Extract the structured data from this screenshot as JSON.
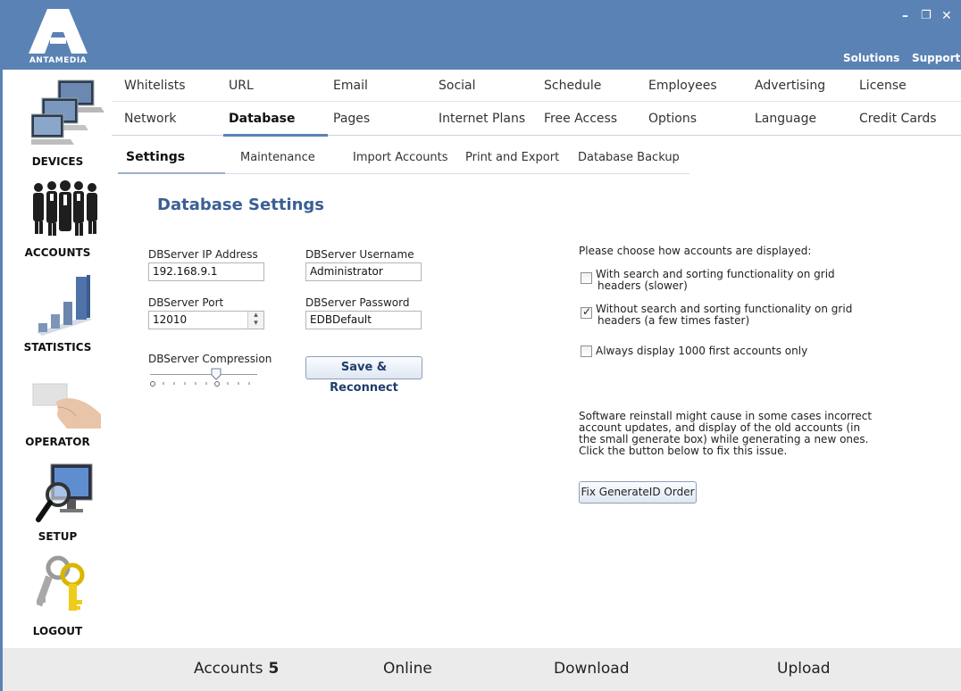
{
  "app": {
    "logo_text": "ANTAMEDIA",
    "minimize_glyph": "–",
    "restore_glyph": "❐",
    "close_glyph": "✕",
    "solutions_label": "Solutions",
    "support_label": "Support"
  },
  "sidebar": {
    "items": [
      {
        "label": "DEVICES",
        "icon": "computers-icon"
      },
      {
        "label": "ACCOUNTS",
        "icon": "people-icon"
      },
      {
        "label": "STATISTICS",
        "icon": "bar-chart-icon"
      },
      {
        "label": "OPERATOR",
        "icon": "hand-card-icon"
      },
      {
        "label": "SETUP",
        "icon": "monitor-magnifier-icon"
      },
      {
        "label": "LOGOUT",
        "icon": "keys-icon"
      }
    ]
  },
  "tabs_row1": [
    "Whitelists",
    "URL",
    "Email",
    "Social",
    "Schedule",
    "Employees",
    "Advertising",
    "License"
  ],
  "tabs_row2": [
    "Network",
    "Database",
    "Pages",
    "Internet Plans",
    "Free Access",
    "Options",
    "Language",
    "Credit Cards"
  ],
  "active_tab": "Database",
  "subtabs": [
    "Settings",
    "Maintenance",
    "Import Accounts",
    "Print and Export",
    "Database Backup"
  ],
  "active_subtab": "Settings",
  "form": {
    "title": "Database Settings",
    "ip_label": "DBServer IP Address",
    "ip_value": "192.168.9.1",
    "username_label": "DBServer Username",
    "username_value": "Administrator",
    "port_label": "DBServer Port",
    "port_value": "12010",
    "password_label": "DBServer Password",
    "password_value": "EDBDefault",
    "compression_label": "DBServer Compression",
    "compression_level": 0.63,
    "save_button": "Save & Reconnect"
  },
  "display_options": {
    "heading": "Please choose how accounts are displayed:",
    "options": [
      {
        "line1": "With search and sorting functionality on grid",
        "line2": "headers (slower)",
        "checked": false
      },
      {
        "line1": "Without search and sorting functionality on grid",
        "line2": "headers (a few times faster)",
        "checked": true
      },
      {
        "line1": "Always display 1000 first accounts only",
        "line2": "",
        "checked": false
      }
    ],
    "check_glyph": "✓"
  },
  "fix": {
    "line1": "Software reinstall might cause in some cases incorrect",
    "line2": "account updates, and display of the old accounts (in",
    "line3": "the small generate box) while generating a new ones.",
    "line4": "Click the button below to fix this issue.",
    "button": "Fix GenerateID Order"
  },
  "status": {
    "accounts_label": "Accounts",
    "accounts_count": "5",
    "online_label": "Online",
    "download_label": "Download",
    "upload_label": "Upload"
  },
  "colors": {
    "titlebar": "#5b82b4",
    "title_text": "#3a5f94",
    "statusbar": "#ebebeb"
  }
}
